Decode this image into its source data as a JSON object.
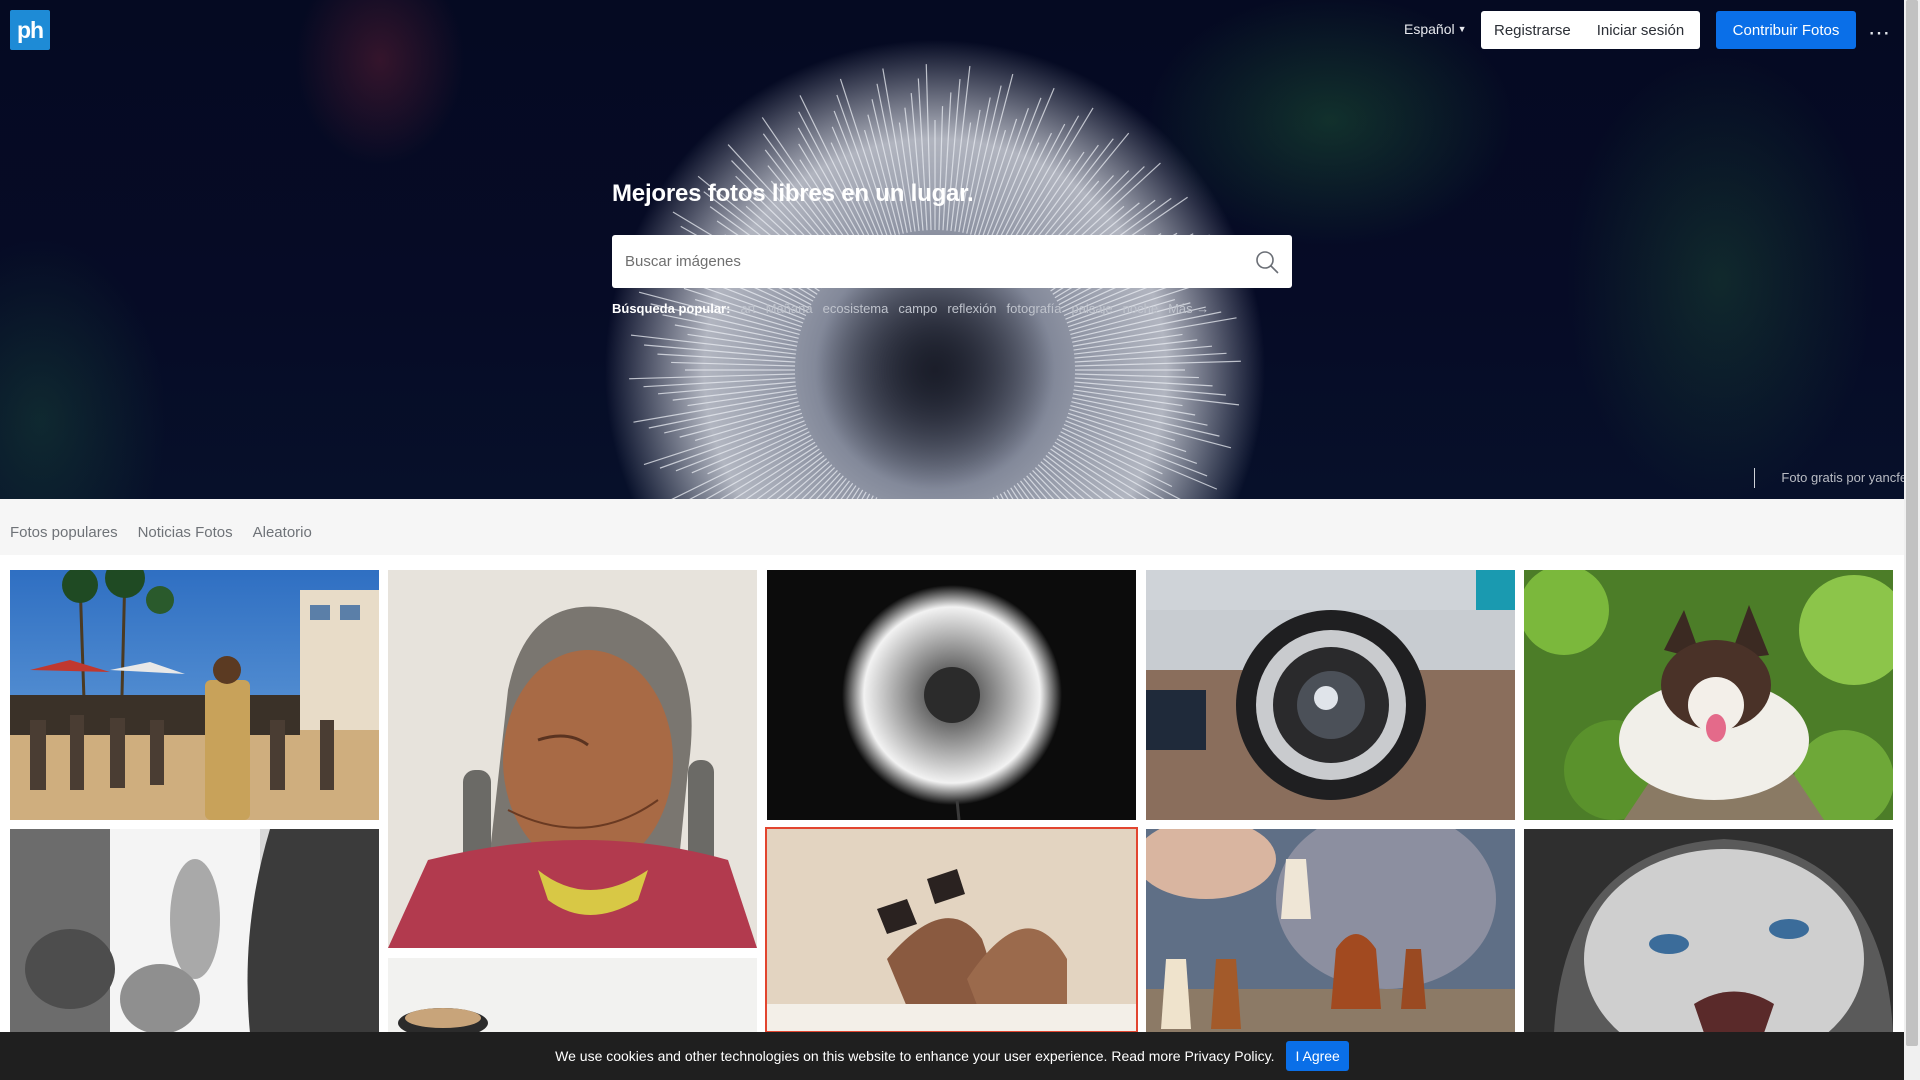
{
  "brand": {
    "logo_text": "ph",
    "color": "#1e8bd6"
  },
  "nav": {
    "language": "Español",
    "register": "Registrarse",
    "login": "Iniciar sesión",
    "contribute": "Contribuir Fotos",
    "more_icon": "more-dots-icon"
  },
  "hero": {
    "title": "Mejores fotos libres en un lugar.",
    "search_placeholder": "Buscar imágenes",
    "popular_label": "Búsqueda popular:",
    "popular_tags": [
      "art",
      "Mañana",
      "ecosistema",
      "campo",
      "reflexión",
      "fotografía",
      "paisaje",
      "noche"
    ],
    "more_link": "Más →",
    "credit": "Foto gratis por yancfei"
  },
  "tabs": [
    "Fotos populares",
    "Noticias Fotos",
    "Aleatorio"
  ],
  "photos": [
    "beach-boardwalk-crowd",
    "elderly-woman-portrait",
    "dandelion-black-background",
    "vintage-camera-lens",
    "corgi-dog-in-leaves",
    "blurred-people-bw",
    "coffee-cup",
    "legs-high-heels",
    "chess-pieces-hand",
    "crying-baby"
  ],
  "cookie": {
    "text": "We use cookies and other technologies on this website to enhance your user experience. Read more Privacy Policy.",
    "button": "I Agree"
  },
  "colors": {
    "accent": "#0a6fe8",
    "hero_bg": "#060b26"
  }
}
